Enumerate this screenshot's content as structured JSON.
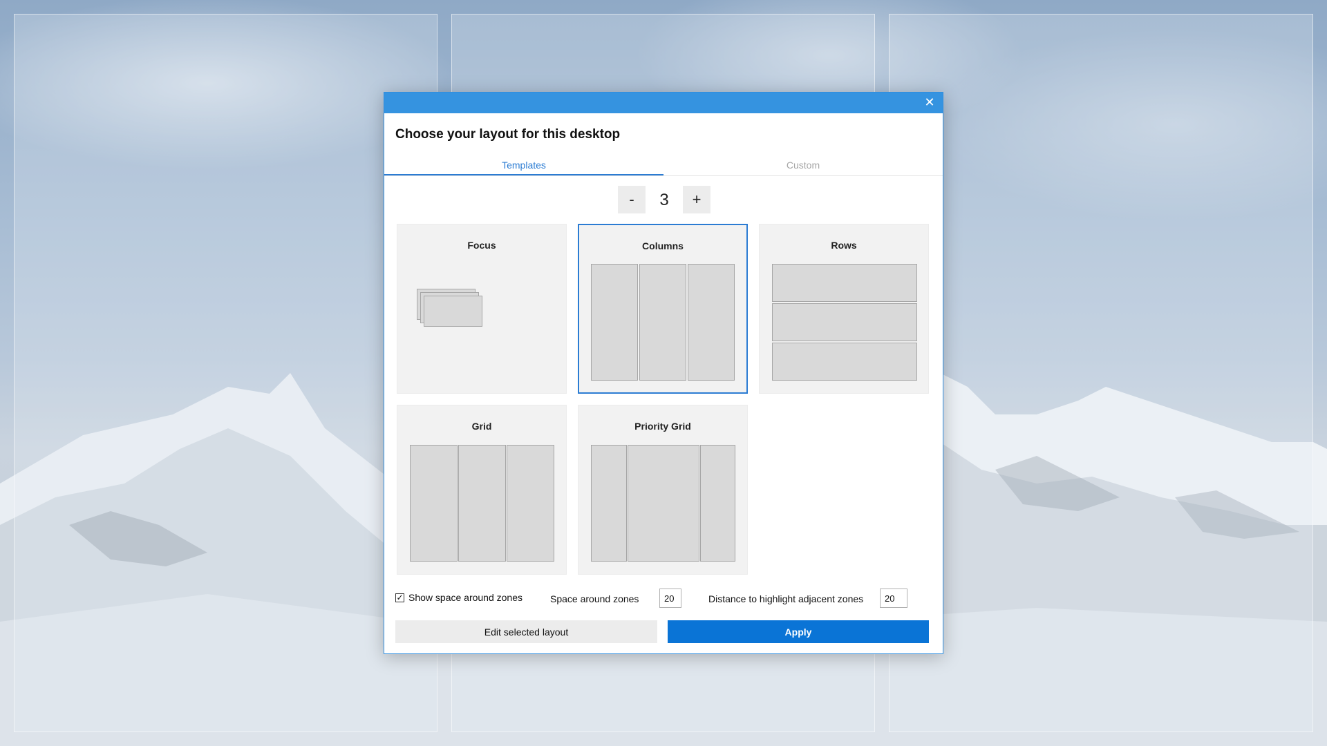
{
  "dialog": {
    "title": "Choose your layout for this desktop",
    "close_icon": "close-icon"
  },
  "tabs": [
    {
      "label": "Templates",
      "active": true
    },
    {
      "label": "Custom",
      "active": false
    }
  ],
  "stepper": {
    "minus_label": "-",
    "value": "3",
    "plus_label": "+"
  },
  "templates": [
    {
      "name": "Focus",
      "selected": false
    },
    {
      "name": "Columns",
      "selected": true
    },
    {
      "name": "Rows",
      "selected": false
    },
    {
      "name": "Grid",
      "selected": false
    },
    {
      "name": "Priority Grid",
      "selected": false
    }
  ],
  "settings": {
    "show_space_label": "Show space around zones",
    "show_space_checked": true,
    "space_label": "Space around zones",
    "space_value": "20",
    "distance_label": "Distance to highlight adjacent zones",
    "distance_value": "20"
  },
  "buttons": {
    "edit_label": "Edit selected layout",
    "apply_label": "Apply"
  },
  "colors": {
    "accent": "#2b7cd3",
    "titlebar": "#3593e0",
    "apply": "#0a74d6"
  }
}
